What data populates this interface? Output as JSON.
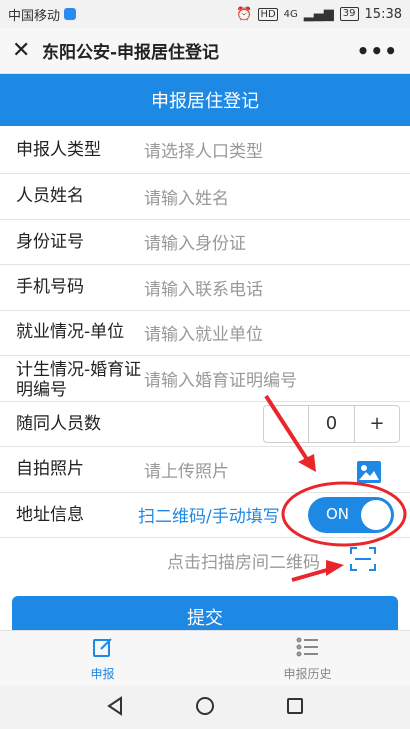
{
  "status_bar": {
    "carrier": "中国移动",
    "signal": "4G",
    "battery": "39",
    "time": "15:38"
  },
  "title_bar": {
    "close_icon": "close-icon",
    "title": "东阳公安-申报居住登记",
    "more_icon": "more-icon"
  },
  "header": {
    "title": "申报居住登记"
  },
  "form": {
    "declarant_type": {
      "label": "申报人类型",
      "placeholder": "请选择人口类型"
    },
    "name": {
      "label": "人员姓名",
      "placeholder": "请输入姓名"
    },
    "id_number": {
      "label": "身份证号",
      "placeholder": "请输入身份证"
    },
    "phone": {
      "label": "手机号码",
      "placeholder": "请输入联系电话"
    },
    "employer": {
      "label": "就业情况-单位",
      "placeholder": "请输入就业单位"
    },
    "family_planning": {
      "label": "计生情况-婚育证明编号",
      "placeholder": "请输入婚育证明编号"
    },
    "companions": {
      "label": "随同人员数",
      "minus": "",
      "value": "0",
      "plus": "+"
    },
    "selfie": {
      "label": "自拍照片",
      "placeholder": "请上传照片",
      "icon": "image-upload-icon"
    },
    "address": {
      "label": "地址信息",
      "mode_text": "扫二维码/手动填写",
      "toggle_label": "ON",
      "toggle_on": true
    },
    "scan": {
      "text": "点击扫描房间二维码",
      "icon": "scan-icon"
    }
  },
  "submit_label": "提交",
  "tabs": [
    {
      "label": "申报",
      "icon": "edit-icon",
      "active": true
    },
    {
      "label": "申报历史",
      "icon": "list-icon",
      "active": false
    }
  ],
  "colors": {
    "primary": "#1e88e5",
    "annotation": "#e8262b"
  }
}
